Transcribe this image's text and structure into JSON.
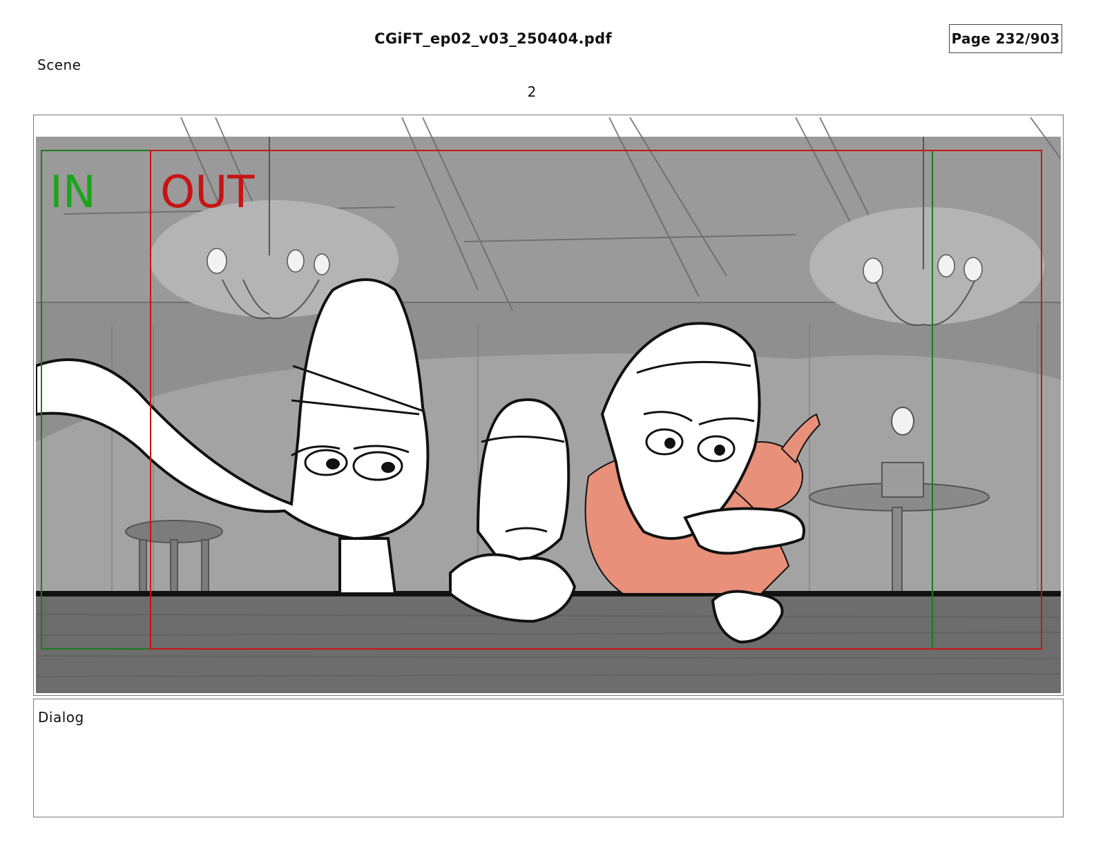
{
  "header": {
    "file_name": "CGiFT_ep02_v03_250404.pdf",
    "page_indicator": "Page 232/903"
  },
  "scene": {
    "label": "Scene",
    "number": "2"
  },
  "panel": {
    "in_marker": "IN",
    "out_marker": "OUT",
    "colors": {
      "in_marker": "#1aa51a",
      "out_marker": "#c81414",
      "background_gray": "#8c8c8c",
      "character_pink": "#e8907a",
      "wood": "#6e6e6e"
    }
  },
  "dialog": {
    "label": "Dialog",
    "text": ""
  }
}
